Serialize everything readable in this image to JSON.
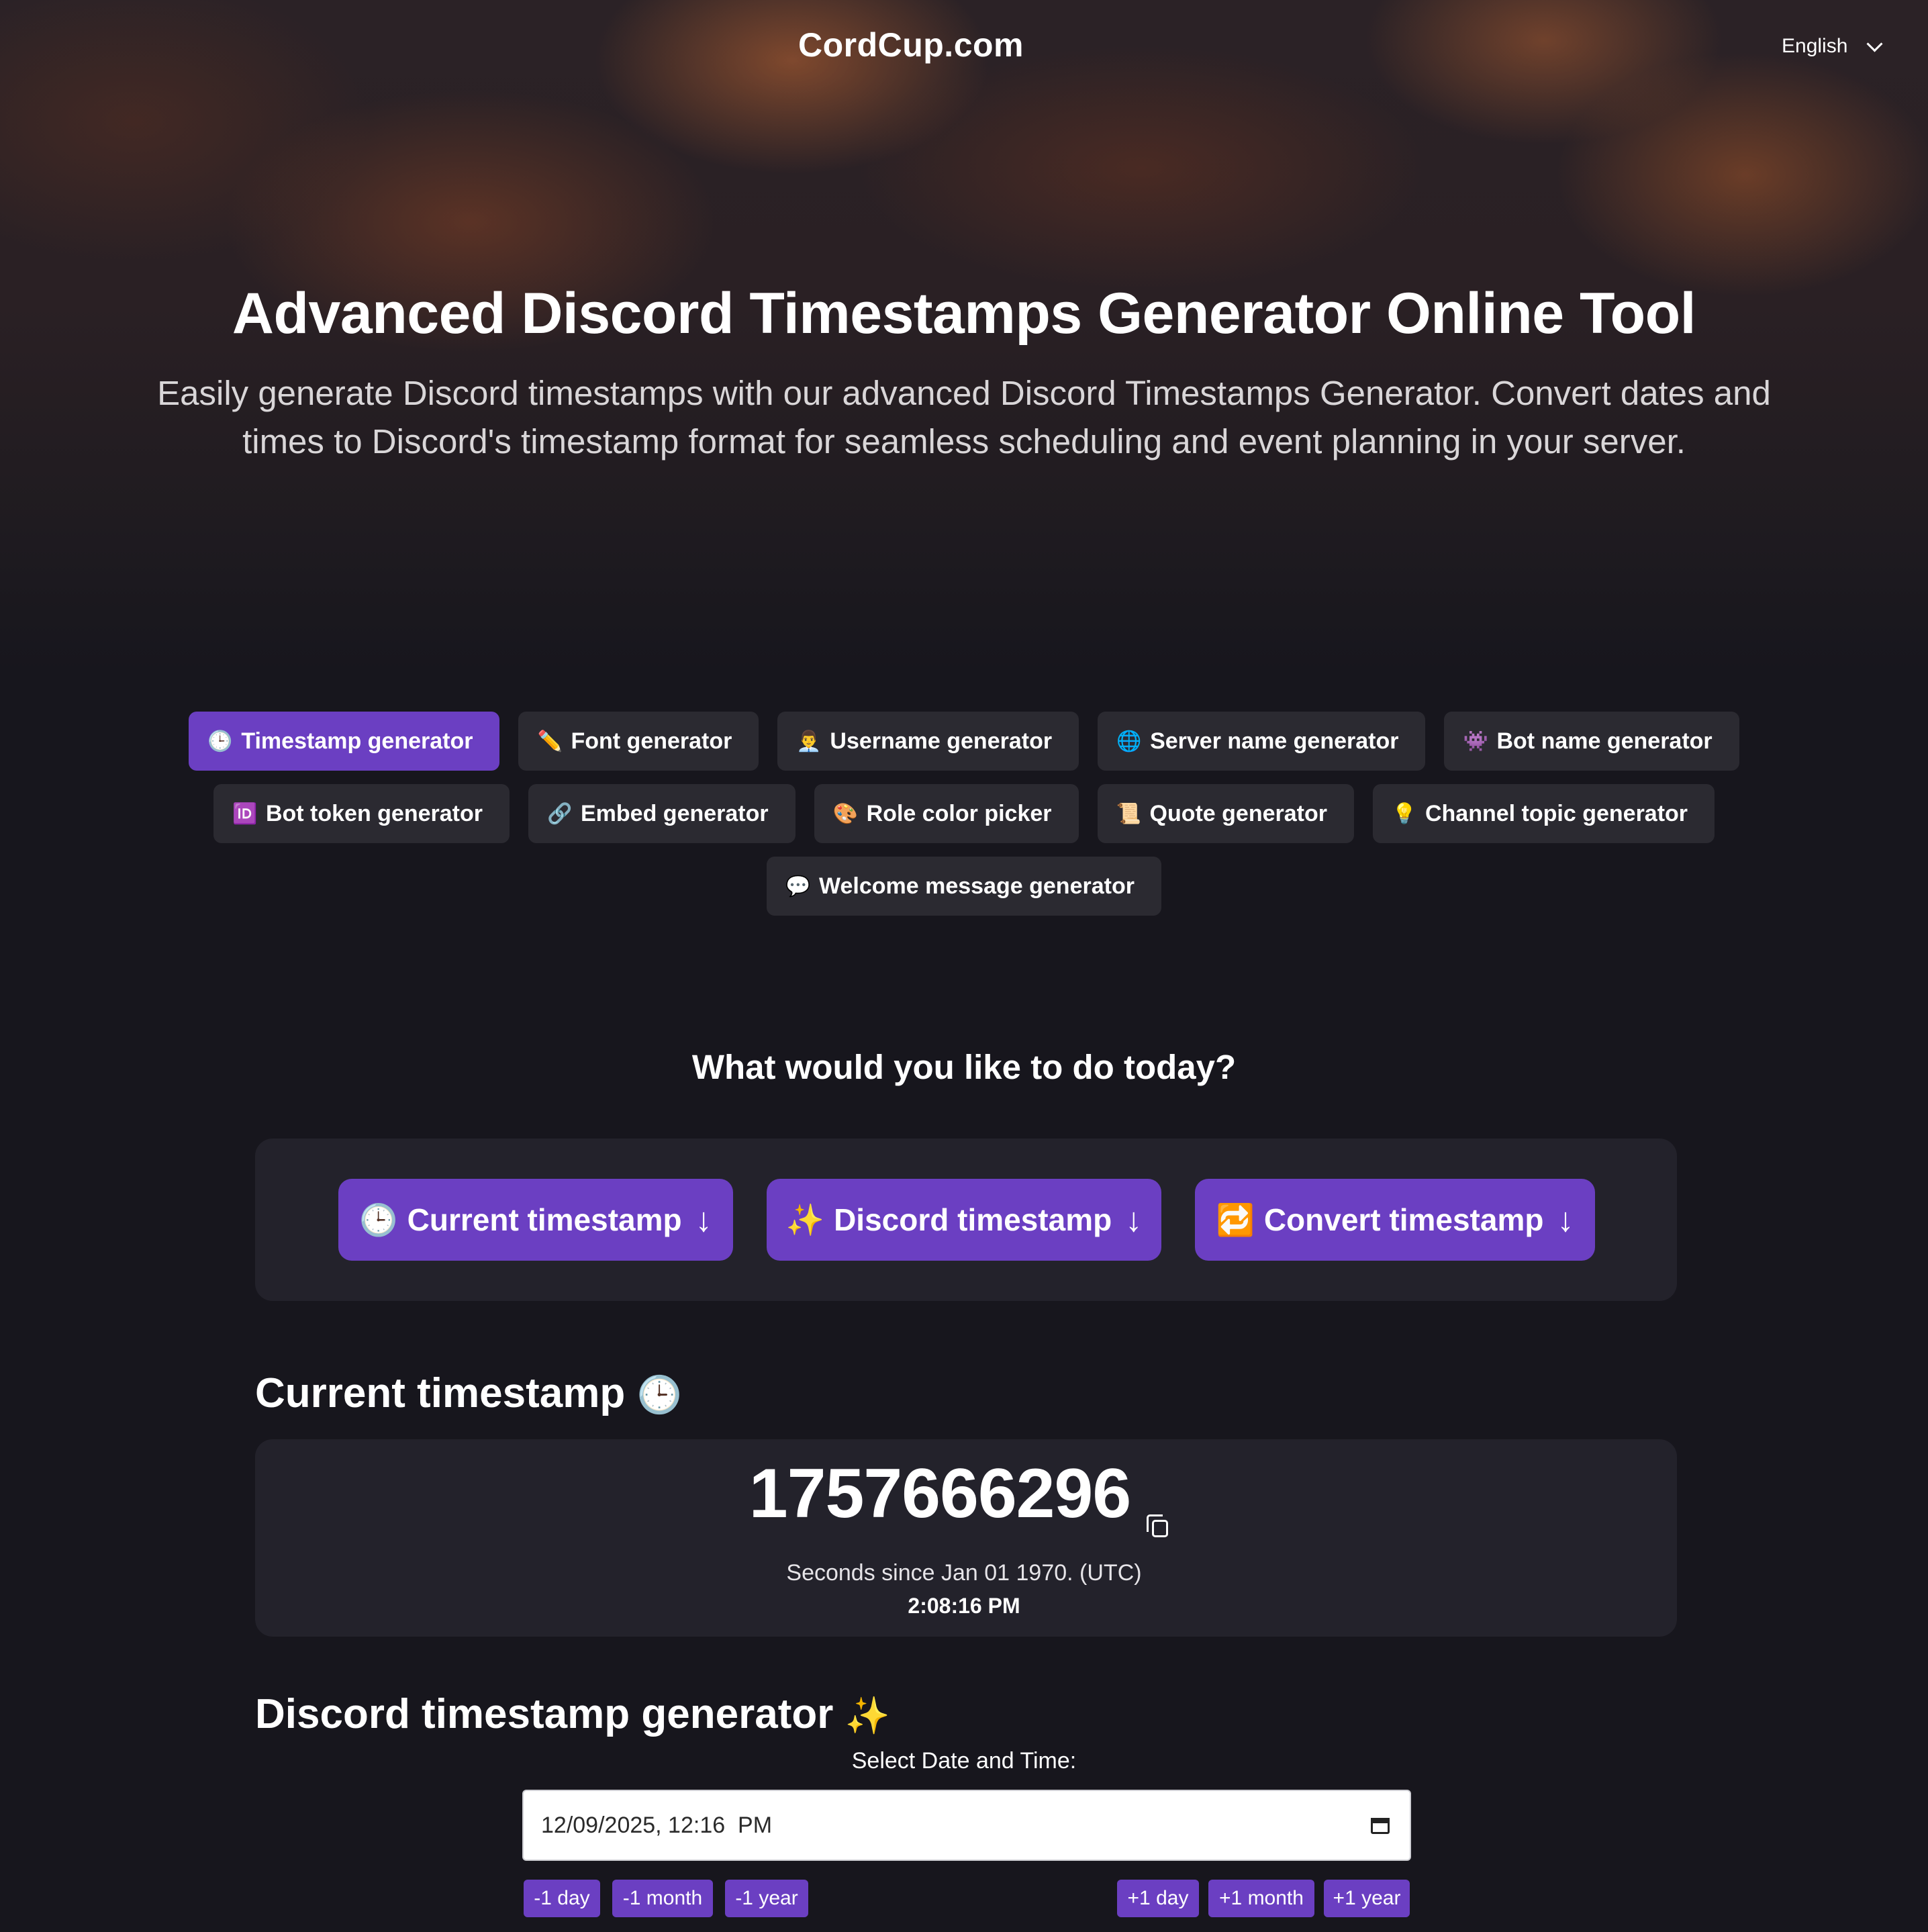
{
  "header": {
    "logo": "CordCup.com",
    "language": "English"
  },
  "hero": {
    "title": "Advanced Discord Timestamps Generator Online Tool",
    "subtitle": "Easily generate Discord timestamps with our advanced Discord Timestamps Generator. Convert dates and times to Discord's timestamp format for seamless scheduling and event planning in your server."
  },
  "tools": [
    {
      "icon": "🕒",
      "label": "Timestamp generator",
      "active": true
    },
    {
      "icon": "✏️",
      "label": "Font generator"
    },
    {
      "icon": "👨‍💼",
      "label": "Username generator"
    },
    {
      "icon": "🌐",
      "label": "Server name generator"
    },
    {
      "icon": "👾",
      "label": "Bot name generator"
    },
    {
      "icon": "🆔",
      "label": "Bot token generator"
    },
    {
      "icon": "🔗",
      "label": "Embed generator"
    },
    {
      "icon": "🎨",
      "label": "Role color picker"
    },
    {
      "icon": "📜",
      "label": "Quote generator"
    },
    {
      "icon": "💡",
      "label": "Channel topic generator"
    },
    {
      "icon": "💬",
      "label": "Welcome message generator"
    }
  ],
  "question": "What would you like to do today?",
  "actions": [
    {
      "icon": "🕒",
      "label": "Current timestamp",
      "arrow": "↓"
    },
    {
      "icon": "✨",
      "label": "Discord timestamp",
      "arrow": "↓"
    },
    {
      "icon": "🔁",
      "label": "Convert timestamp",
      "arrow": "↓"
    }
  ],
  "current": {
    "heading": "Current timestamp",
    "heading_icon": "🕒",
    "value": "1757666296",
    "description": "Seconds since Jan 01 1970. (UTC)",
    "time": "2:08:16 PM"
  },
  "generator": {
    "heading": "Discord timestamp generator",
    "heading_icon": "✨",
    "select_label": "Select Date and Time:",
    "datetime_value": "12/09/2025, 12:16  PM",
    "minus": [
      "-1 day",
      "-1 month",
      "-1 year"
    ],
    "plus": [
      "+1 day",
      "+1 month",
      "+1 year"
    ]
  },
  "colors": {
    "accent": "#6b3fc2",
    "background": "#17161d",
    "panel": "#23222b",
    "chip": "#2b2a31"
  }
}
